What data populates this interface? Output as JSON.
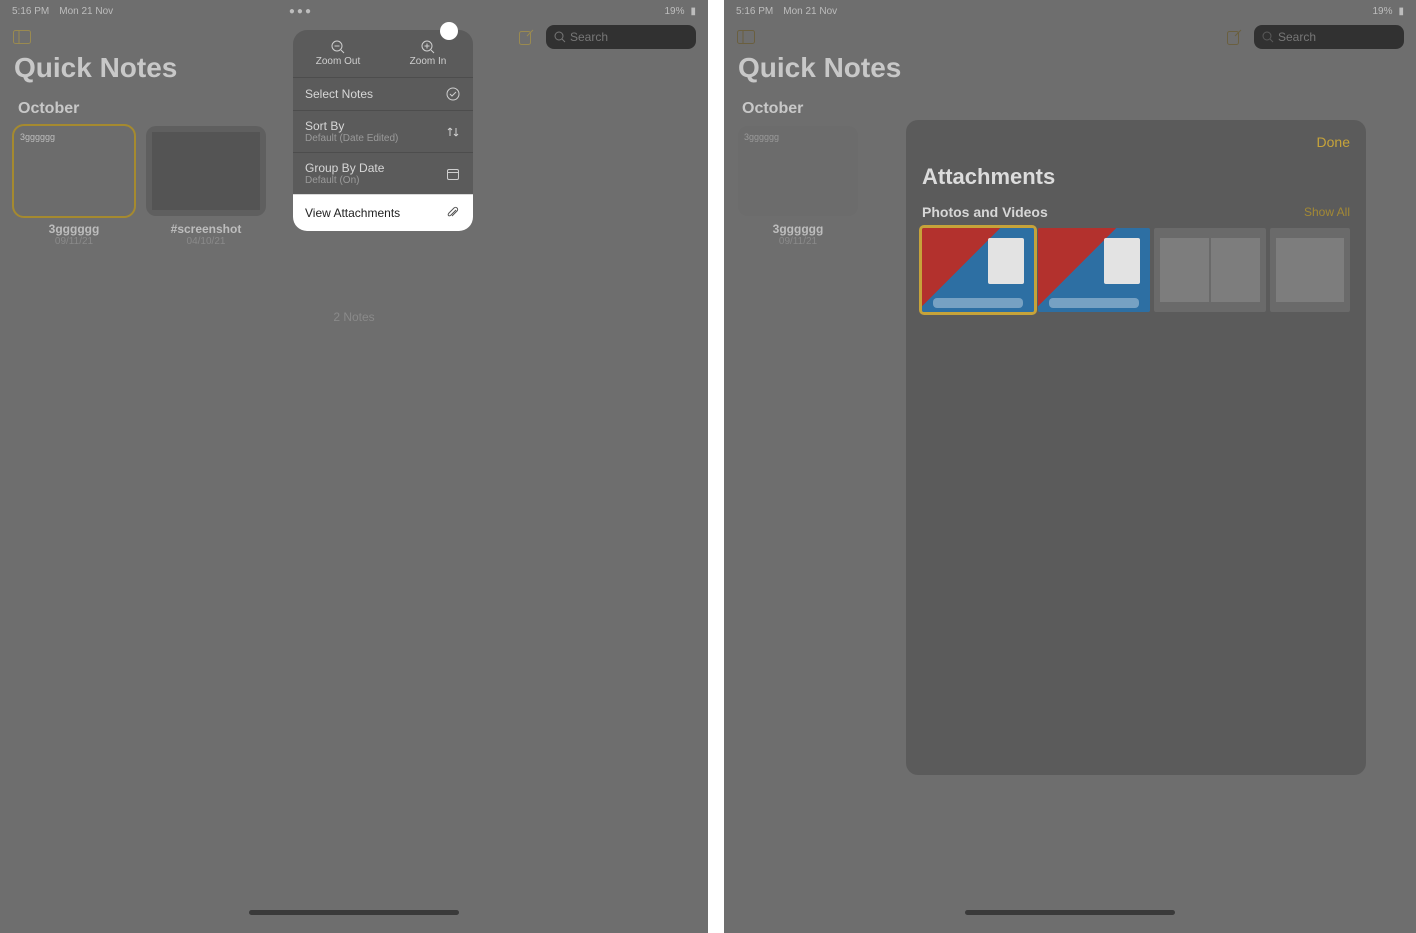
{
  "status": {
    "time": "5:16 PM",
    "date": "Mon 21 Nov",
    "battery": "19%"
  },
  "toolbar": {
    "search_placeholder": "Search"
  },
  "page": {
    "title": "Quick Notes",
    "section": "October",
    "count_label": "2 Notes"
  },
  "notes": [
    {
      "title": "3gggggg",
      "date": "09/11/21"
    },
    {
      "title": "#screenshot",
      "date": "04/10/21"
    }
  ],
  "popover": {
    "zoom_out": "Zoom Out",
    "zoom_in": "Zoom In",
    "select_notes": "Select Notes",
    "sort_by": {
      "label": "Sort By",
      "sub": "Default (Date Edited)"
    },
    "group_by_date": {
      "label": "Group By Date",
      "sub": "Default (On)"
    },
    "view_attachments": "View Attachments"
  },
  "sheet": {
    "done": "Done",
    "title": "Attachments",
    "section": "Photos and Videos",
    "show_all": "Show All"
  }
}
